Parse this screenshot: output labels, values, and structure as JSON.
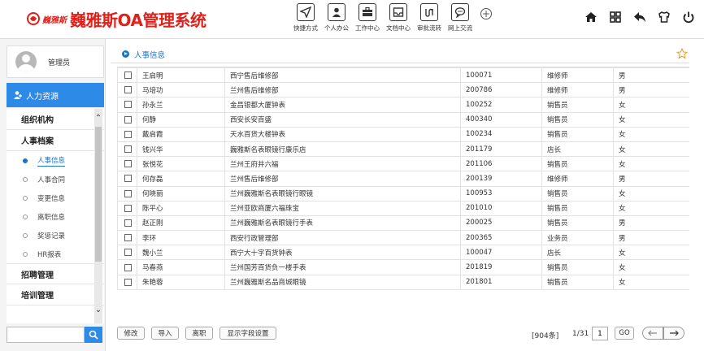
{
  "app": {
    "brand": "巍雅斯",
    "title": "巍雅斯OA管理系统",
    "accent_color": "#2d8ae6",
    "logo_color": "#e0201a"
  },
  "quick_nav": [
    {
      "label": "快捷方式",
      "icon": "send-icon"
    },
    {
      "label": "个人办公",
      "icon": "person-icon"
    },
    {
      "label": "工作中心",
      "icon": "briefcase-icon"
    },
    {
      "label": "文档中心",
      "icon": "inbox-icon"
    },
    {
      "label": "审批流转",
      "icon": "flow-icon"
    },
    {
      "label": "网上交流",
      "icon": "chat-icon"
    }
  ],
  "top_actions": [
    "home-icon",
    "apps-icon",
    "back-icon",
    "theme-icon",
    "power-icon"
  ],
  "user": {
    "name": "管理员"
  },
  "module": {
    "label": "人力资源"
  },
  "menu": {
    "groups": [
      {
        "label": "组织机构"
      },
      {
        "label": "人事档案"
      }
    ],
    "subitems": [
      {
        "label": "人事信息",
        "current": true
      },
      {
        "label": "人事合同"
      },
      {
        "label": "变更信息"
      },
      {
        "label": "离职信息"
      },
      {
        "label": "奖惩记录"
      },
      {
        "label": "HR报表"
      }
    ],
    "groups_after": [
      {
        "label": "招聘管理"
      },
      {
        "label": "培训管理"
      }
    ]
  },
  "search": {
    "value": "",
    "placeholder": ""
  },
  "breadcrumb": {
    "label": "人事信息"
  },
  "table": {
    "rows": [
      [
        "王启明",
        "西宁售后维修部",
        "100071",
        "维修师",
        "男"
      ],
      [
        "马培功",
        "兰州售后维修部",
        "200786",
        "维修师",
        "男"
      ],
      [
        "孙永兰",
        "金昌银都大厦钟表",
        "100252",
        "销售员",
        "女"
      ],
      [
        "何静",
        "西安长安百盛",
        "400340",
        "销售员",
        "女"
      ],
      [
        "戴启霞",
        "天水百货大楼钟表",
        "100234",
        "销售员",
        "女"
      ],
      [
        "钱兴华",
        "巍雅斯名表眼镜行康乐店",
        "201179",
        "店长",
        "女"
      ],
      [
        "张悦花",
        "兰州王府井六福",
        "201106",
        "销售员",
        "女"
      ],
      [
        "何存磊",
        "兰州售后维修部",
        "200139",
        "维修师",
        "男"
      ],
      [
        "何晓丽",
        "兰州巍雅斯名表眼镜行眼镜",
        "100953",
        "销售员",
        "女"
      ],
      [
        "陈平心",
        "兰州亚欧商厦六福珠宝",
        "201010",
        "销售员",
        "女"
      ],
      [
        "赵正刚",
        "兰州巍雅斯名表眼镜行手表",
        "200025",
        "销售员",
        "男"
      ],
      [
        "李环",
        "西安行政管理部",
        "200365",
        "业务员",
        "男"
      ],
      [
        "魏小兰",
        "西宁大十字百货钟表",
        "100047",
        "店长",
        "女"
      ],
      [
        "马春燕",
        "兰州国芳百货负一楼手表",
        "201819",
        "销售员",
        "女"
      ],
      [
        "朱艳蓉",
        "兰州巍雅斯名品商城眼镜",
        "201801",
        "销售员",
        "女"
      ]
    ]
  },
  "footer": {
    "buttons": [
      "修改",
      "导入",
      "离职",
      "显示字段设置"
    ],
    "count": "[904条]",
    "page_info": "1/31",
    "page_value": "1",
    "go": "GO"
  }
}
